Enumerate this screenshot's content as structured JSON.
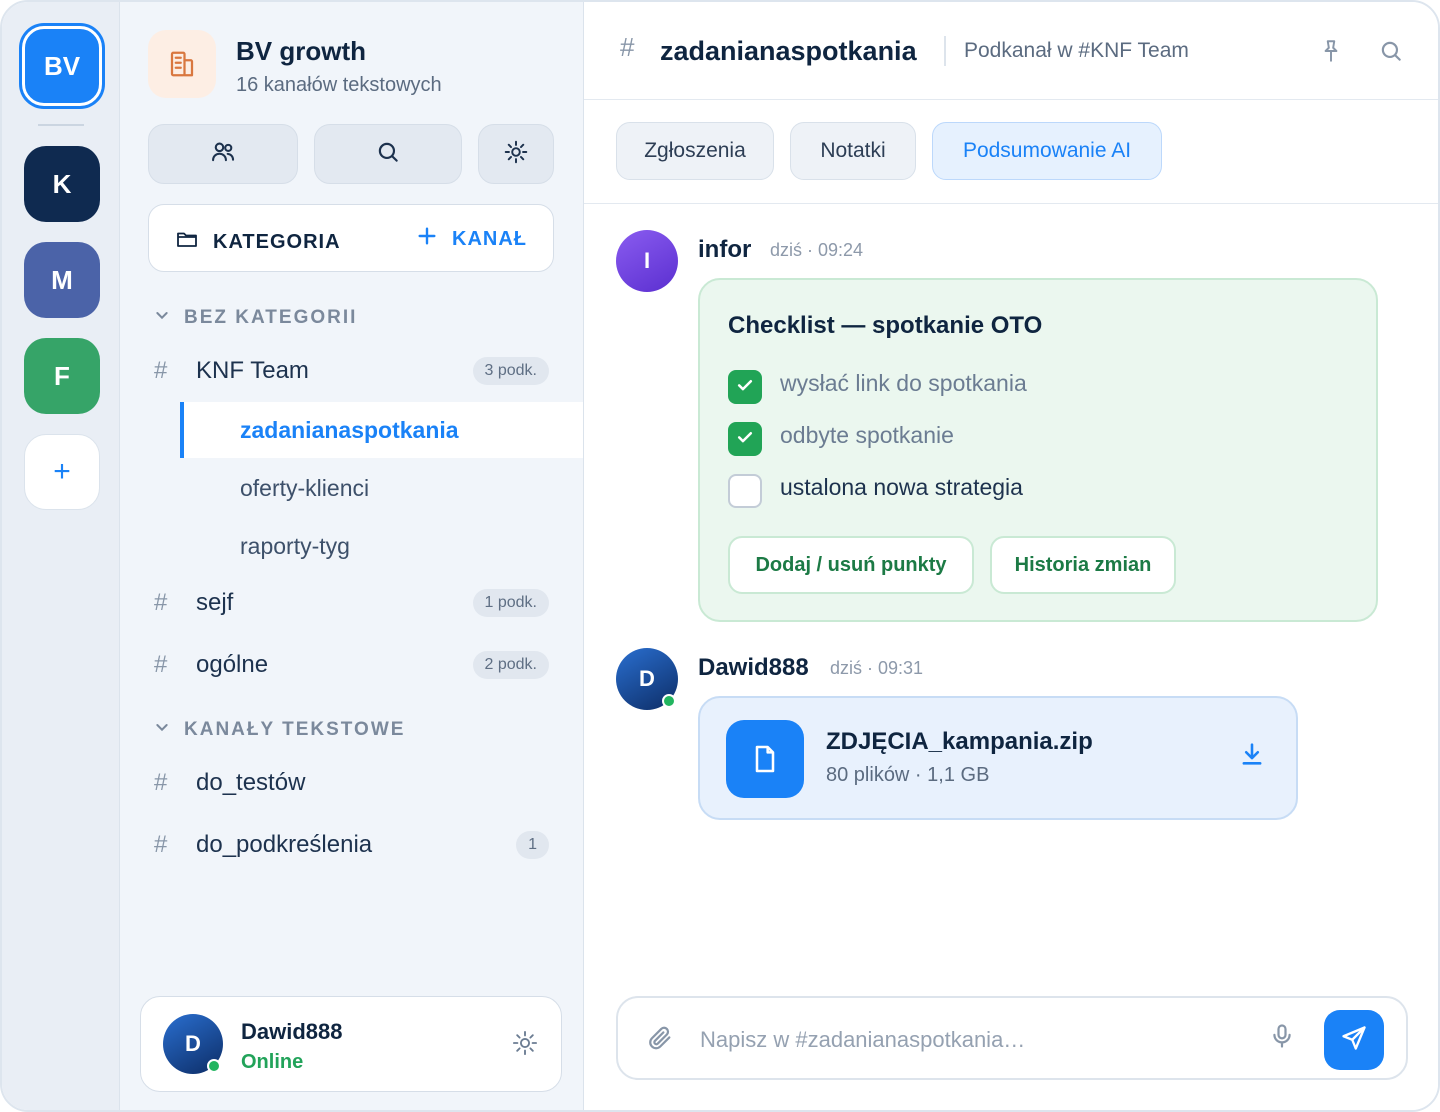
{
  "servers": [
    {
      "label": "BV",
      "color": "#1a82f7",
      "active": true
    },
    {
      "label": "K",
      "color": "#0f2a50"
    },
    {
      "label": "M",
      "color": "#4b63a8"
    },
    {
      "label": "F",
      "color": "#36a468"
    },
    {
      "label": "+"
    }
  ],
  "sidebar": {
    "server_name": "BV growth",
    "server_sub": "16 kanałów tekstowych",
    "category_label": "KATEGORIA",
    "channel_label": "KANAŁ",
    "sections": [
      {
        "title": "BEZ KATEGORII"
      },
      {
        "title": "KANAŁY TEKSTOWE"
      }
    ],
    "channels": [
      {
        "name": "KNF Team",
        "badge": "3 podk."
      },
      {
        "name": "sejf",
        "badge": "1 podk."
      },
      {
        "name": "ogólne",
        "badge": "2 podk."
      },
      {
        "name": "do_testów"
      },
      {
        "name": "do_podkreślenia",
        "badge": "1"
      }
    ],
    "subchannels": [
      {
        "name": "zadanianaspotkania",
        "active": true
      },
      {
        "name": "oferty-klienci"
      },
      {
        "name": "raporty-tyg"
      }
    ],
    "hash": "#",
    "user": {
      "avatar": "D",
      "name": "Dawid888",
      "status": "Online"
    }
  },
  "header": {
    "hash": "#",
    "title": "zadanianaspotkania",
    "subtitle": "Podkanał w #KNF Team"
  },
  "tabs": [
    {
      "label": "Zgłoszenia"
    },
    {
      "label": "Notatki"
    },
    {
      "label": "Podsumowanie AI",
      "active": true
    }
  ],
  "messages": [
    {
      "avatar": "I",
      "author": "infor",
      "time": "dziś · 09:24",
      "checklist": {
        "title": "Checklist — spotkanie OTO",
        "items": [
          {
            "text": "wysłać link do spotkania",
            "checked": true
          },
          {
            "text": "odbyte spotkanie",
            "checked": true
          },
          {
            "text": "ustalona nowa strategia",
            "checked": false
          }
        ],
        "buttons": [
          "Dodaj / usuń punkty",
          "Historia zmian"
        ]
      }
    },
    {
      "avatar": "D",
      "author": "Dawid888",
      "time": "dziś · 09:31",
      "file": {
        "name": "ZDJĘCIA_kampania.zip",
        "meta": "80 plików · 1,1 GB"
      }
    }
  ],
  "composer": {
    "placeholder": "Napisz w #zadanianaspotkania…",
    "value": ""
  },
  "colors": {
    "accent": "#1a82f7",
    "online": "#22b55f",
    "success": "#21a456"
  },
  "icons": [
    "users-icon",
    "search-icon",
    "settings-icon",
    "folder-icon",
    "plus-icon",
    "chevron-down-icon",
    "building-icon",
    "pin-icon",
    "file-icon",
    "download-icon",
    "paperclip-icon",
    "microphone-icon",
    "send-icon",
    "check-icon"
  ]
}
